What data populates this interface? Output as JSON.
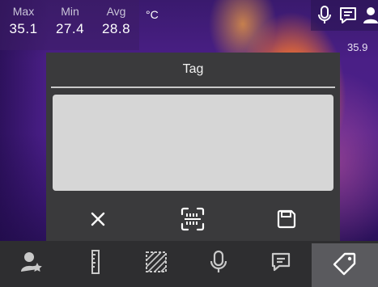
{
  "stats": {
    "max_label": "Max",
    "min_label": "Min",
    "avg_label": "Avg",
    "max_value": "35.1",
    "min_value": "27.4",
    "avg_value": "28.8",
    "unit": "°C"
  },
  "scale": {
    "top_value": "35.9"
  },
  "dialog": {
    "title": "Tag",
    "input_value": "",
    "actions": [
      "close-icon",
      "barcode-scan-icon",
      "save-icon"
    ]
  },
  "toolbar": {
    "items": [
      "user-star-icon",
      "ruler-icon",
      "area-hatch-icon",
      "microphone-icon",
      "comment-icon",
      "tag-icon"
    ],
    "active": "tag-icon"
  },
  "colors": {
    "dialog_bg": "#3a3a3c",
    "input_bg": "#d6d6d6",
    "toolbar_bg": "#2e2e30",
    "active_item_bg": "#5a5a5e"
  }
}
